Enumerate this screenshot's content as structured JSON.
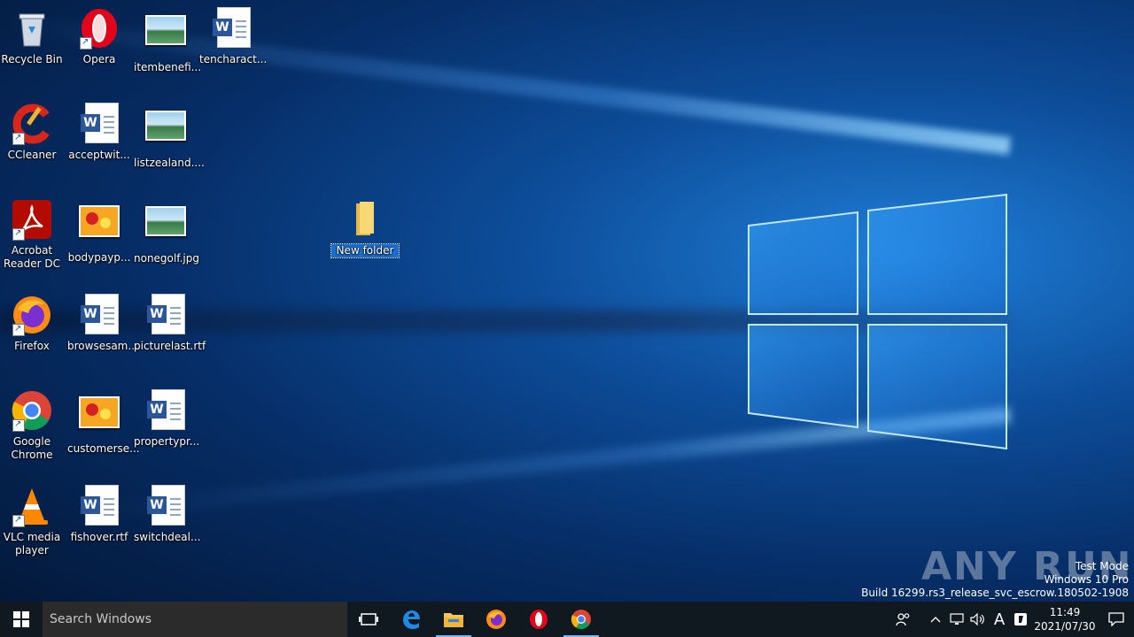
{
  "desktop": {
    "icons": [
      {
        "label": "Recycle Bin"
      },
      {
        "label": "Opera"
      },
      {
        "label": "itembenefi..."
      },
      {
        "label": "tencharact..."
      },
      {
        "label": "CCleaner"
      },
      {
        "label": "acceptwit..."
      },
      {
        "label": "listzealand...."
      },
      {
        "label": "Acrobat Reader DC"
      },
      {
        "label": "bodypayp..."
      },
      {
        "label": "nonegolf.jpg"
      },
      {
        "label": "Firefox"
      },
      {
        "label": "browsesam..."
      },
      {
        "label": "picturelast.rtf"
      },
      {
        "label": "Google Chrome"
      },
      {
        "label": "customerse..."
      },
      {
        "label": "propertypr..."
      },
      {
        "label": "VLC media player"
      },
      {
        "label": "fishover.rtf"
      },
      {
        "label": "switchdeal..."
      }
    ],
    "new_folder": {
      "label": "New folder"
    }
  },
  "watermark": {
    "brand": "ANY RUN",
    "line1": "Test Mode",
    "line2": "Windows 10 Pro",
    "line3": "Build 16299.rs3_release_svc_escrow.180502-1908"
  },
  "taskbar": {
    "search_placeholder": "Search Windows",
    "apps": [
      "task-view",
      "edge",
      "file-explorer",
      "firefox",
      "opera",
      "chrome"
    ],
    "language": "A",
    "time": "11:49",
    "date": "2021/07/30"
  },
  "colors": {
    "taskbar_bg": "#101820",
    "selection": "#1b6dce",
    "word_blue": "#2b579a"
  }
}
